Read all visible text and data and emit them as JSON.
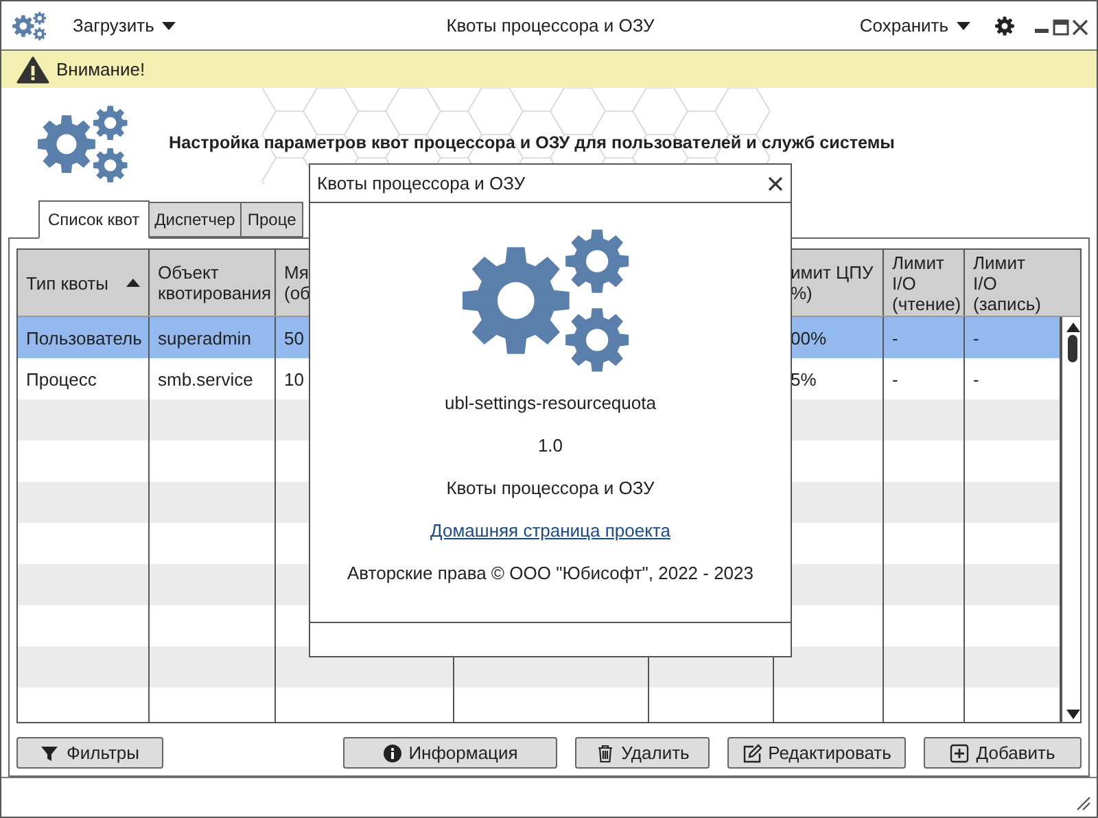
{
  "window": {
    "title": "Квоты процессора и ОЗУ"
  },
  "header": {
    "load_menu": "Загрузить",
    "save_menu": "Сохранить"
  },
  "warning": {
    "text": "Внимание!"
  },
  "banner": {
    "text": "Настройка параметров квот процессора и ОЗУ для пользователей и служб системы"
  },
  "tabs": [
    {
      "label": "Список квот",
      "selected": true
    },
    {
      "label": "Диспетчер",
      "selected": false
    },
    {
      "label": "Проце",
      "selected": false
    }
  ],
  "table": {
    "columns": [
      {
        "label": "Тип квоты",
        "sorted_ascending": true
      },
      {
        "label": "Объект\nквотирования"
      },
      {
        "label": "Мя\n(об"
      },
      {
        "label": "имит ЦПУ\n%)"
      },
      {
        "label": "Лимит\nI/O\n(чтение)"
      },
      {
        "label": "Лимит\nI/O\n(запись)"
      }
    ],
    "rows": [
      {
        "cells": [
          "Пользователь",
          "superadmin",
          "50",
          "00%",
          "-",
          "-"
        ],
        "selected": true
      },
      {
        "cells": [
          "Процесс",
          "smb.service",
          "10",
          "5%",
          "-",
          "-"
        ],
        "selected": false
      }
    ]
  },
  "buttons": [
    {
      "label": "Фильтры",
      "kind": "filter"
    },
    {
      "label": "Информация",
      "kind": "info"
    },
    {
      "label": "Удалить",
      "kind": "delete"
    },
    {
      "label": "Редактировать",
      "kind": "edit"
    },
    {
      "label": "Добавить",
      "kind": "add"
    }
  ],
  "about_dialog": {
    "title": "Квоты процессора и ОЗУ",
    "app_name": "ubl-settings-resourcequota",
    "version": "1.0",
    "description": "Квоты процессора и ОЗУ",
    "link": "Домашняя страница проекта",
    "copyright": "Авторские права © ООО \"Юбисофт\", 2022 - 2023"
  }
}
